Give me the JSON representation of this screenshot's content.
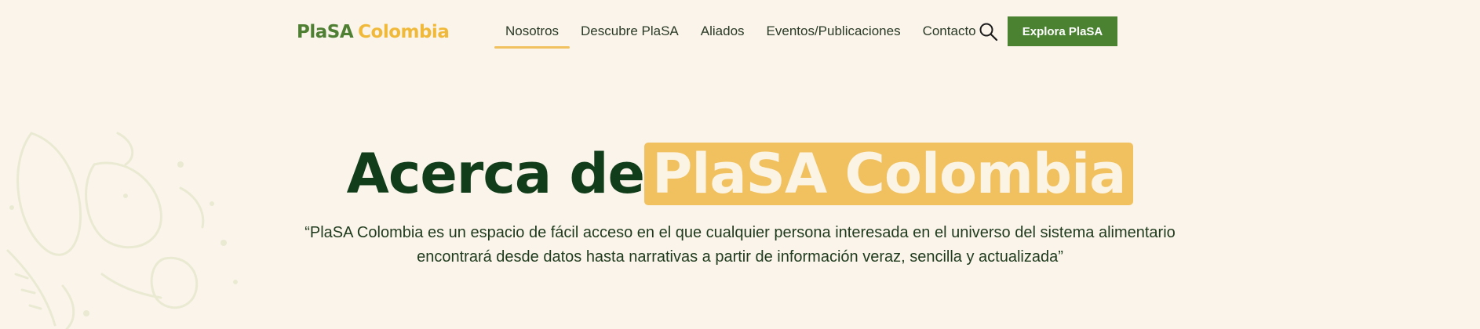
{
  "logo": {
    "part1": "PlaSA",
    "part2": "Colombia"
  },
  "nav": {
    "items": [
      {
        "label": "Nosotros",
        "active": true
      },
      {
        "label": "Descubre PlaSA",
        "active": false
      },
      {
        "label": "Aliados",
        "active": false
      },
      {
        "label": "Eventos/Publicaciones",
        "active": false
      },
      {
        "label": "Contacto",
        "active": false
      }
    ]
  },
  "search": {
    "icon": "search-icon"
  },
  "cta": {
    "label": "Explora PlaSA"
  },
  "hero": {
    "title_plain": "Acerca de",
    "title_highlight": "PlaSA Colombia",
    "quote_line1": "“PlaSA Colombia es un espacio de fácil acceso en el que cualquier persona interesada en el universo del sistema alimentario",
    "quote_line2": "encontrará desde datos hasta narrativas a partir de información veraz, sencilla y actualizada”"
  },
  "colors": {
    "background": "#faf4ea",
    "brand_green": "#4a8232",
    "dark_green": "#123d1a",
    "accent_yellow": "#f0c15e",
    "decor_green": "#dfe3c4"
  }
}
